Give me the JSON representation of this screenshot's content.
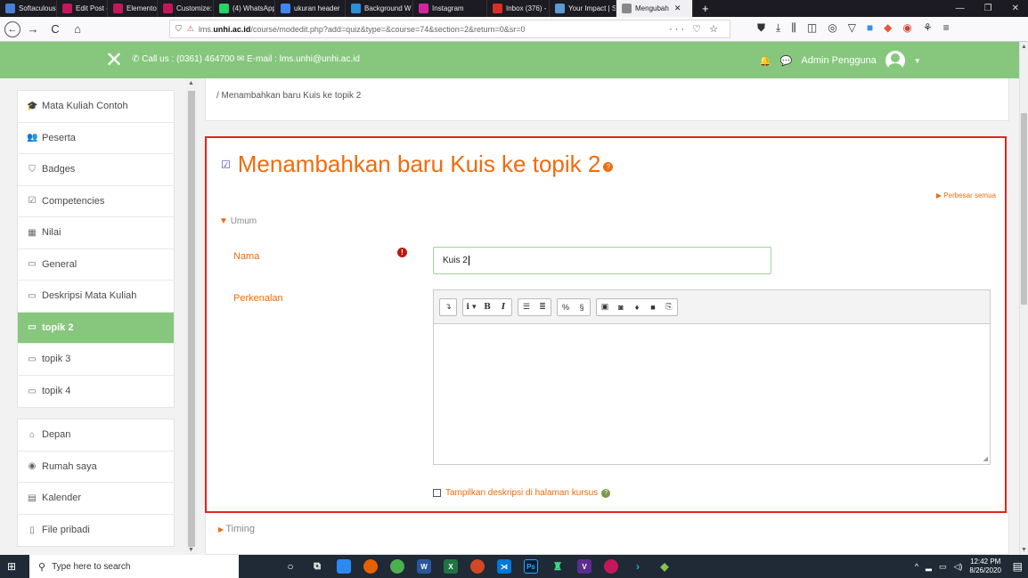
{
  "browser": {
    "tabs": [
      {
        "label": "Softaculous - S",
        "color": "#4a7fd6"
      },
      {
        "label": "Edit Post ‹ — V",
        "color": "#c2185b"
      },
      {
        "label": "Elementor | Do",
        "color": "#c2185b"
      },
      {
        "label": "Customize: Do",
        "color": "#c2185b"
      },
      {
        "label": "(4) WhatsApp",
        "color": "#25d366"
      },
      {
        "label": "ukuran header",
        "color": "#4285f4"
      },
      {
        "label": "Background W",
        "color": "#2b8fd6"
      },
      {
        "label": "Instagram",
        "color": "#d6249f"
      },
      {
        "label": "Inbox (376) - l",
        "color": "#d93025"
      },
      {
        "label": "Your Impact | S",
        "color": "#5a9bd4"
      },
      {
        "label": "Mengubah",
        "color": "#888888"
      }
    ],
    "url_prefix": "lms.",
    "url_domain": "unhi.ac.id",
    "url_path": "/course/modedit.php?add=quiz&type=&course=74&section=2&return=0&sr=0",
    "url_actions": "··· ♡ ☆"
  },
  "site": {
    "contact": "Call us : (0361) 464700 ✉ E-mail : lms.unhi@unhi.ac.id",
    "user_name": "Admin Pengguna"
  },
  "sidebar": {
    "group1": [
      {
        "label": "Mata Kuliah Contoh",
        "icon": "graduation-cap-icon",
        "glyph": "🎓"
      },
      {
        "label": "Peserta",
        "icon": "users-icon",
        "glyph": "👥"
      },
      {
        "label": "Badges",
        "icon": "shield-icon",
        "glyph": "⛉"
      },
      {
        "label": "Competencies",
        "icon": "check-square-icon",
        "glyph": "☑"
      },
      {
        "label": "Nilai",
        "icon": "table-icon",
        "glyph": "▦"
      },
      {
        "label": "General",
        "icon": "folder-icon",
        "glyph": "▭"
      },
      {
        "label": "Deskripsi Mata Kuliah",
        "icon": "folder-icon",
        "glyph": "▭"
      },
      {
        "label": "topik 2",
        "icon": "folder-icon",
        "glyph": "▭",
        "active": true
      },
      {
        "label": "topik 3",
        "icon": "folder-icon",
        "glyph": "▭"
      },
      {
        "label": "topik 4",
        "icon": "folder-icon",
        "glyph": "▭"
      }
    ],
    "group2": [
      {
        "label": "Depan",
        "icon": "home-icon",
        "glyph": "⌂"
      },
      {
        "label": "Rumah saya",
        "icon": "dashboard-icon",
        "glyph": "◉"
      },
      {
        "label": "Kalender",
        "icon": "calendar-icon",
        "glyph": "▤"
      },
      {
        "label": "File pribadi",
        "icon": "file-icon",
        "glyph": "▯"
      }
    ]
  },
  "main": {
    "breadcrumb": "/ Menambahkan baru Kuis ke topik 2",
    "title": "Menambahkan baru Kuis ke topik 2",
    "expand_all": "Perbesar semua",
    "section_general": "Umum",
    "name_label": "Nama",
    "name_value": "Kuis 2",
    "intro_label": "Perkenalan",
    "show_desc_label": "Tampilkan deskripsi di halaman kursus",
    "section_timing": "Timing"
  },
  "taskbar": {
    "search_placeholder": "Type here to search",
    "time": "12:42 PM",
    "date": "8/26/2020"
  },
  "colors": {
    "accent_green": "#86c77d",
    "accent_orange": "#f06b0d",
    "highlight_red": "#e1261c"
  }
}
